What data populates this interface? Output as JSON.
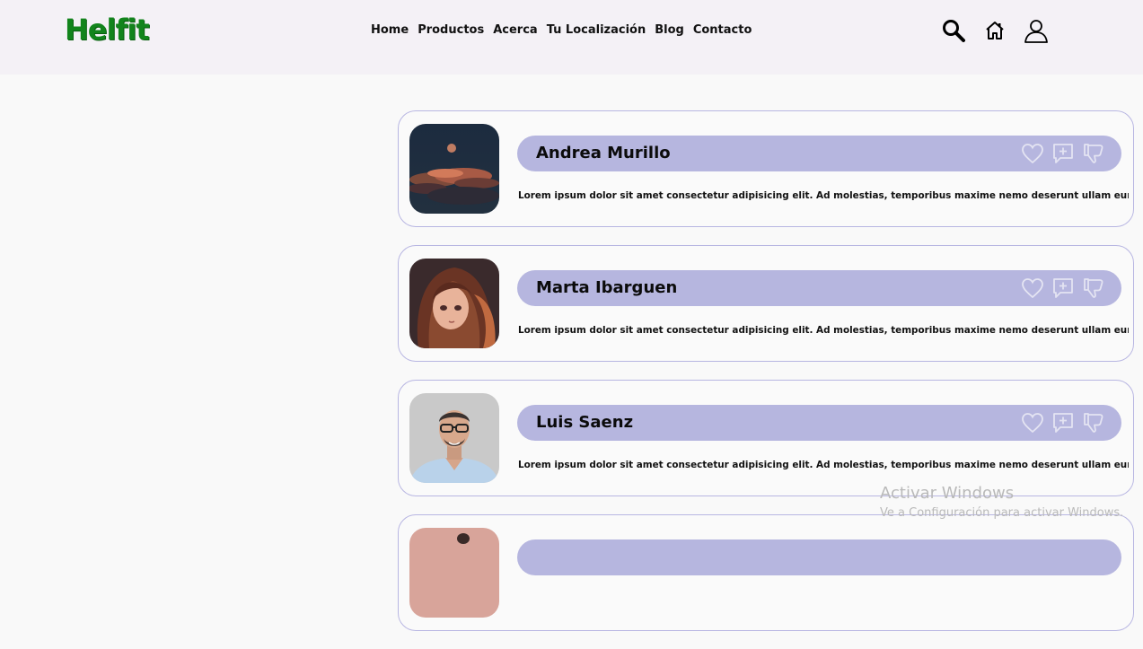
{
  "brand": {
    "logo_text": "Helfit",
    "logo_color": "#12841c"
  },
  "nav": {
    "items": [
      "Home",
      "Productos",
      "Acerca",
      "Tu Localización",
      "Blog",
      "Contacto"
    ]
  },
  "header_icons": [
    "search-icon",
    "home-icon",
    "user-icon"
  ],
  "colors": {
    "header_bg": "#f4f1f6",
    "page_bg": "#f9f9f9",
    "name_bar": "#b6b6df",
    "card_border": "#b8b6e2"
  },
  "posts": [
    {
      "name": "Andrea Murillo",
      "text": "Lorem ipsum dolor sit amet consectetur adipisicing elit. Ad molestias, temporibus maxime nemo deserunt ullam eum providen",
      "avatar": "moon-clouds-image"
    },
    {
      "name": "Marta Ibarguen",
      "text": "Lorem ipsum dolor sit amet consectetur adipisicing elit. Ad molestias, temporibus maxime nemo deserunt ullam eum providen",
      "avatar": "anime-girl-image"
    },
    {
      "name": "Luis Saenz",
      "text": "Lorem ipsum dolor sit amet consectetur adipisicing elit. Ad molestias, temporibus maxime nemo deserunt ullam eum providen",
      "avatar": "man-portrait-image"
    },
    {
      "name": "",
      "text": "",
      "avatar": "partial-image"
    }
  ],
  "post_actions": [
    "heart-icon",
    "comment-add-icon",
    "thumbs-down-icon"
  ],
  "watermark": {
    "line1": "Activar Windows",
    "line2": "Ve a Configuración para activar Windows."
  }
}
